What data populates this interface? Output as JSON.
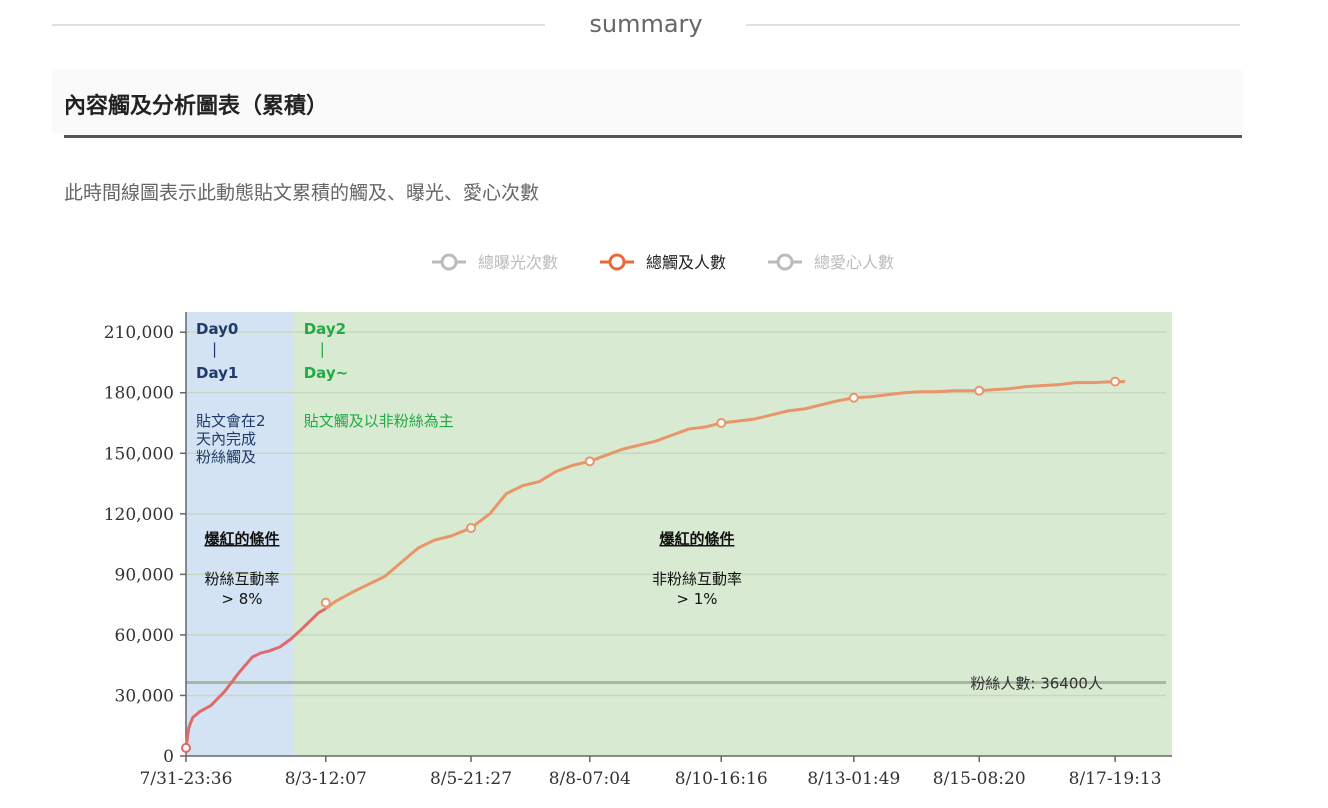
{
  "header": {
    "summary_label": "summary"
  },
  "section": {
    "title": "內容觸及分析圖表（累積）",
    "description": "此時間線圖表示此動態貼文累積的觸及、曝光、愛心次數"
  },
  "colors": {
    "reach_line": "#e8956a",
    "reach_early": "#e06a6a",
    "day0_band": "#d3e3f3",
    "day2_band": "#d9ead3",
    "day0_text": "#1f3a6b",
    "day2_text": "#22aa44",
    "legend_inactive": "#bbbbbb",
    "legend_active": "#e86a3a",
    "grid": "#c8d8c0",
    "follower_line": "#a8b8a0"
  },
  "chart_data": {
    "type": "line",
    "title": "",
    "xlabel": "",
    "ylabel": "",
    "ylim": [
      0,
      220000
    ],
    "yticks": [
      0,
      30000,
      60000,
      90000,
      120000,
      150000,
      180000,
      210000
    ],
    "ytick_labels": [
      "0",
      "30,000",
      "60,000",
      "90,000",
      "120,000",
      "150,000",
      "180,000",
      "210,000"
    ],
    "x_range": [
      0,
      17.85
    ],
    "xticks": [
      0,
      2.53,
      5.16,
      7.31,
      9.69,
      12.09,
      14.36,
      16.82
    ],
    "xtick_labels": [
      "7/31-23:36",
      "8/3-12:07",
      "8/5-21:27",
      "8/8-07:04",
      "8/10-16:16",
      "8/13-01:49",
      "8/15-08:20",
      "8/17-19:13"
    ],
    "legend": [
      {
        "label": "總曝光次數",
        "active": false
      },
      {
        "label": "總觸及人數",
        "active": true
      },
      {
        "label": "總愛心人數",
        "active": false
      }
    ],
    "series": [
      {
        "name": "總觸及人數",
        "x": [
          0,
          0.05,
          0.12,
          0.25,
          0.45,
          0.7,
          0.95,
          1.2,
          1.35,
          1.5,
          1.7,
          1.9,
          2.1,
          2.25,
          2.4,
          2.53,
          2.7,
          3.0,
          3.3,
          3.6,
          3.9,
          4.2,
          4.5,
          4.8,
          5.16,
          5.5,
          5.8,
          6.1,
          6.4,
          6.7,
          7.0,
          7.31,
          7.6,
          7.9,
          8.2,
          8.5,
          8.8,
          9.1,
          9.4,
          9.69,
          10.0,
          10.3,
          10.6,
          10.9,
          11.2,
          11.5,
          11.8,
          12.09,
          12.4,
          12.7,
          13.0,
          13.3,
          13.6,
          13.9,
          14.1,
          14.36,
          14.6,
          14.9,
          15.2,
          15.5,
          15.8,
          16.1,
          16.4,
          16.82,
          17.0
        ],
        "y": [
          4000,
          14000,
          19000,
          22000,
          25000,
          32000,
          41000,
          49000,
          51000,
          52000,
          54000,
          58000,
          63000,
          67000,
          71000,
          73000,
          76500,
          81000,
          85000,
          89000,
          96000,
          103000,
          107000,
          109000,
          113000,
          120000,
          130000,
          134000,
          136000,
          141000,
          144000,
          146000,
          149000,
          152000,
          154000,
          156000,
          159000,
          162000,
          163000,
          165000,
          166000,
          167000,
          169000,
          171000,
          172000,
          174000,
          176000,
          177500,
          178000,
          179000,
          180000,
          180500,
          180500,
          181000,
          181000,
          181000,
          181500,
          182000,
          183000,
          183500,
          184000,
          185000,
          185000,
          185500,
          185500
        ],
        "markers_x": [
          0,
          2.53,
          5.16,
          7.31,
          9.69,
          12.09,
          14.36,
          16.82
        ],
        "markers_y": [
          4000,
          76000,
          113000,
          146000,
          165000,
          177500,
          181000,
          185500
        ]
      }
    ],
    "reference_line": {
      "value": 36400,
      "label": "粉絲人數: 36400人"
    },
    "regions": [
      {
        "x_range": [
          0,
          1.95
        ],
        "heading_top": "Day0",
        "heading_sep": "|",
        "heading_bottom": "Day1",
        "desc": [
          "貼文會在2",
          "天內完成",
          "粉絲觸及"
        ],
        "condition_title": "爆紅的條件",
        "condition": [
          "粉絲互動率",
          "> 8%"
        ]
      },
      {
        "x_range": [
          1.95,
          17.85
        ],
        "heading_top": "Day2",
        "heading_sep": "|",
        "heading_bottom": "Day~",
        "desc": [
          "貼文觸及以非粉絲為主"
        ],
        "condition_title": "爆紅的條件",
        "condition": [
          "非粉絲互動率",
          "> 1%"
        ]
      }
    ]
  }
}
